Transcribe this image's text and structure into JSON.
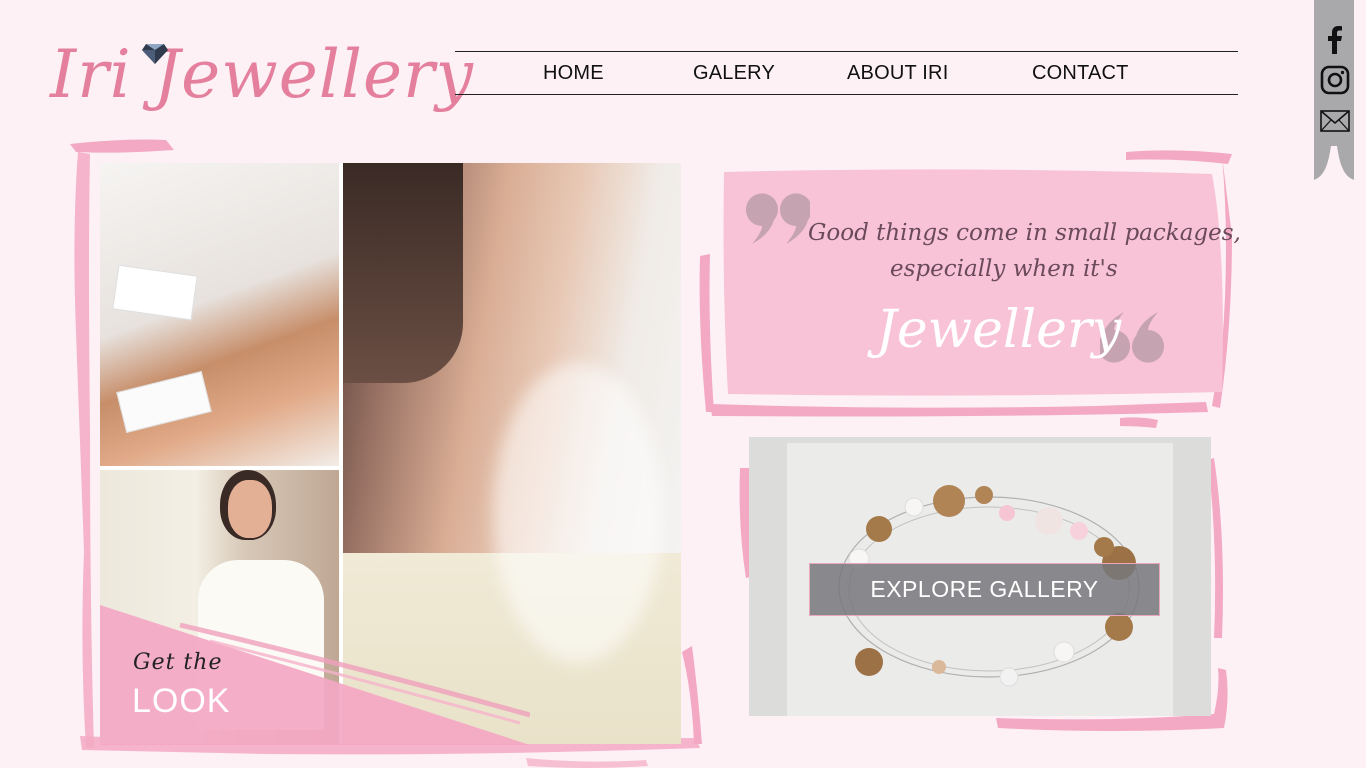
{
  "brand": {
    "name": "Iri Jewellery"
  },
  "nav": {
    "home": "HOME",
    "galery": "GALERY",
    "about": "ABOUT IRI",
    "contact": "CONTACT"
  },
  "social": {
    "icons": [
      "facebook-icon",
      "instagram-icon",
      "mail-icon"
    ]
  },
  "hero": {
    "get_the": "Get the",
    "look": "LOOK"
  },
  "quote": {
    "line1": "Good things come in small packages,",
    "line2": "especially when it's",
    "emphasis": "Jewellery"
  },
  "gallery": {
    "button_label": "EXPLORE GALLERY"
  },
  "colors": {
    "accent_pink": "#e4809e",
    "panel_pink": "#f8c3d6",
    "background": "#fdf1f5",
    "social_bar": "#a9a9ab"
  }
}
